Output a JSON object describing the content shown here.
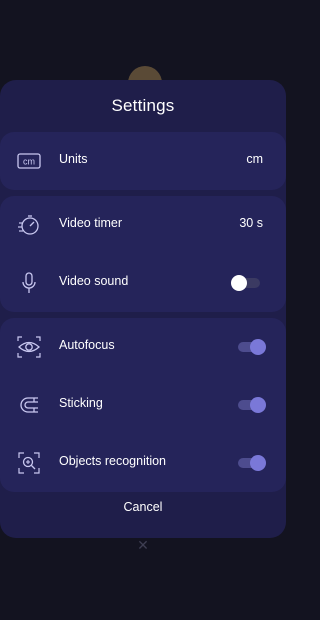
{
  "dialog": {
    "title": "Settings",
    "cancel_label": "Cancel"
  },
  "groups": [
    {
      "rows": [
        {
          "label": "Units",
          "icon": "cm-ruler-icon",
          "value": "cm",
          "icon_text": "cm"
        }
      ]
    },
    {
      "rows": [
        {
          "label": "Video timer",
          "icon": "timer-icon",
          "value": "30 s"
        },
        {
          "label": "Video sound",
          "icon": "microphone-icon",
          "toggle": false
        }
      ]
    },
    {
      "rows": [
        {
          "label": "Autofocus",
          "icon": "eye-focus-icon",
          "toggle": true
        },
        {
          "label": "Sticking",
          "icon": "magnet-icon",
          "toggle": true
        },
        {
          "label": "Objects recognition",
          "icon": "object-scan-icon",
          "toggle": true
        }
      ]
    }
  ],
  "colors": {
    "background": "#131320",
    "sheet": "#1f1e4a",
    "group": "#25245a",
    "toggle_on": "#7a78d8",
    "toggle_off_knob": "#ffffff"
  }
}
